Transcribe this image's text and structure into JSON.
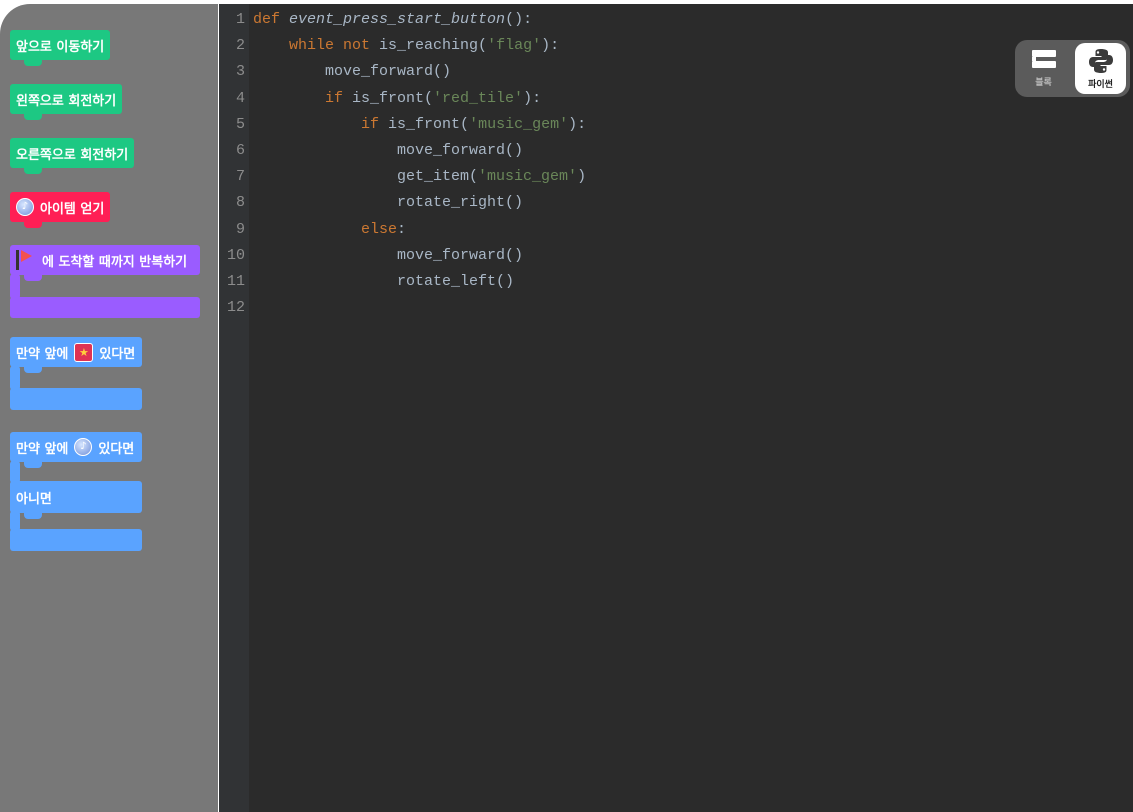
{
  "palette": {
    "move_forward": "앞으로 이동하기",
    "turn_left": "왼쪽으로 회전하기",
    "turn_right": "오른쪽으로 회전하기",
    "get_item": "아이템 얻기",
    "repeat_until": "에 도착할 때까지 반복하기",
    "if_front_tile": [
      "만약 앞에",
      "있다면"
    ],
    "if_front_gem": [
      "만약 앞에",
      "있다면"
    ],
    "else": "아니면"
  },
  "toggle": {
    "blocks": "블록",
    "python": "파이썬",
    "active": "python"
  },
  "colors": {
    "keyword": "#cc7832",
    "string": "#6a8759",
    "text": "#a9b7c6",
    "background": "#2b2b2b"
  },
  "code": [
    {
      "n": "1",
      "t": [
        [
          "kw",
          "def "
        ],
        [
          "fn",
          "event_press_start_button"
        ],
        [
          "",
          "():"
        ]
      ]
    },
    {
      "n": "2",
      "t": [
        [
          "",
          "    "
        ],
        [
          "kw",
          "while not "
        ],
        [
          "",
          "is_reaching("
        ],
        [
          "st",
          "'flag'"
        ],
        [
          "",
          "):"
        ]
      ]
    },
    {
      "n": "3",
      "t": [
        [
          "",
          "        move_forward()"
        ]
      ]
    },
    {
      "n": "4",
      "t": [
        [
          "",
          "        "
        ],
        [
          "kw",
          "if "
        ],
        [
          "",
          "is_front("
        ],
        [
          "st",
          "'red_tile'"
        ],
        [
          "",
          "):"
        ]
      ]
    },
    {
      "n": "5",
      "t": [
        [
          "",
          "            "
        ],
        [
          "kw",
          "if "
        ],
        [
          "",
          "is_front("
        ],
        [
          "st",
          "'music_gem'"
        ],
        [
          "",
          "):"
        ]
      ]
    },
    {
      "n": "6",
      "t": [
        [
          "",
          "                move_forward()"
        ]
      ]
    },
    {
      "n": "7",
      "t": [
        [
          "",
          "                get_item("
        ],
        [
          "st",
          "'music_gem'"
        ],
        [
          "",
          ")"
        ]
      ]
    },
    {
      "n": "8",
      "t": [
        [
          "",
          "                rotate_right()"
        ]
      ]
    },
    {
      "n": "9",
      "t": [
        [
          "",
          "            "
        ],
        [
          "kw",
          "else"
        ],
        [
          "",
          ":"
        ]
      ]
    },
    {
      "n": "10",
      "t": [
        [
          "",
          "                move_forward()"
        ]
      ]
    },
    {
      "n": "11",
      "t": [
        [
          "",
          "                rotate_left()"
        ]
      ]
    },
    {
      "n": "12",
      "t": []
    }
  ]
}
